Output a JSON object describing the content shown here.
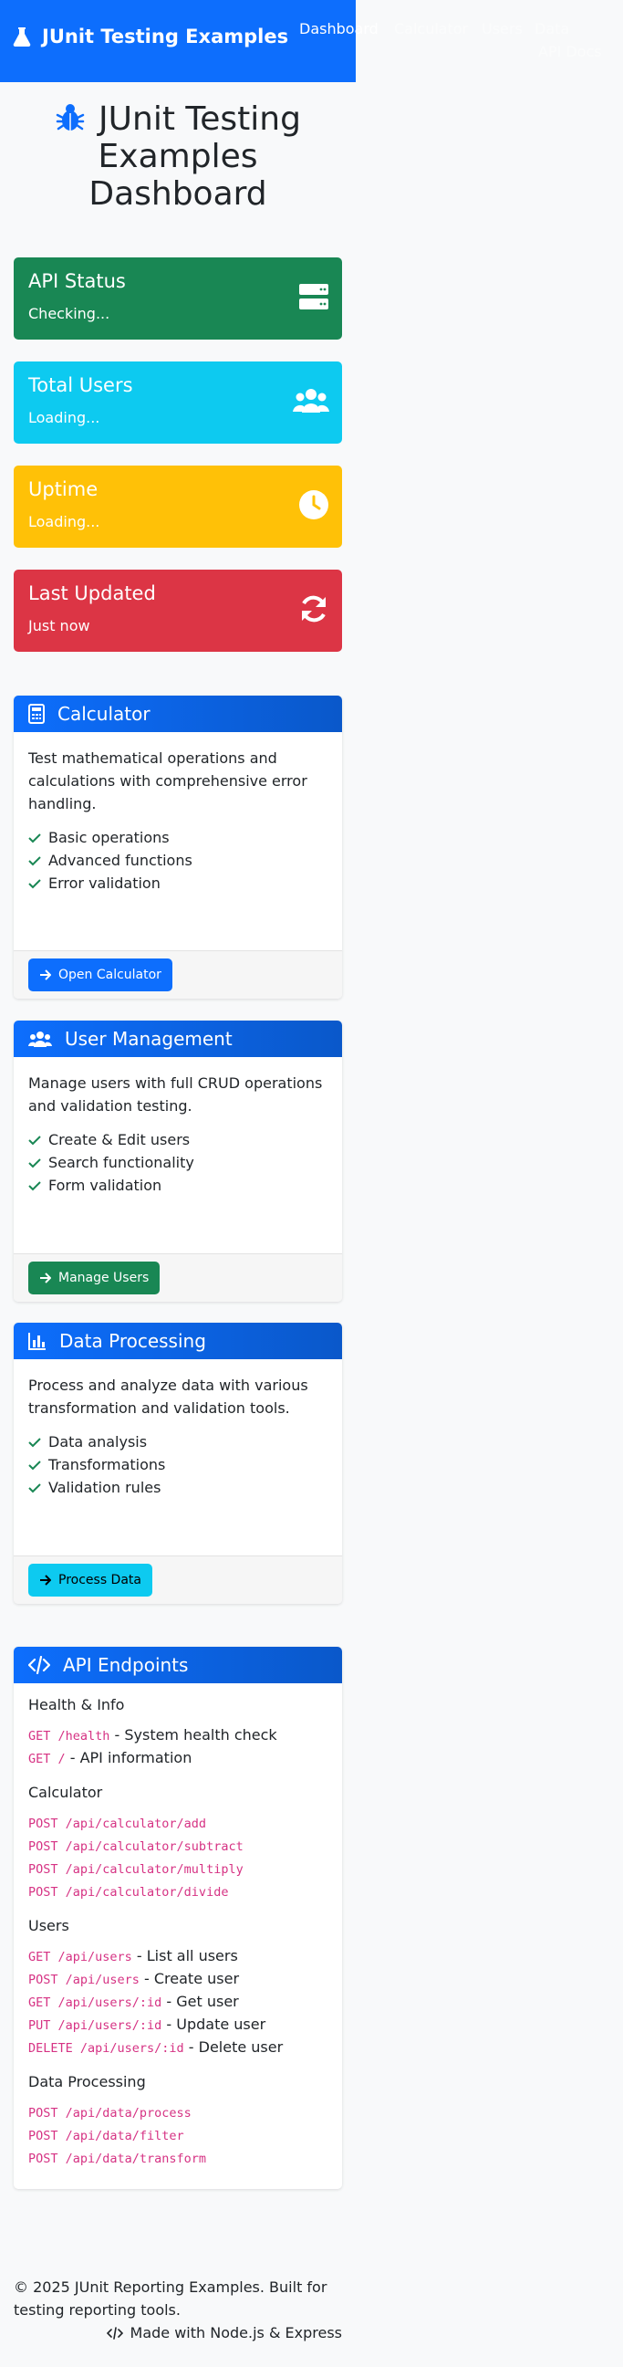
{
  "navbar": {
    "brand": "JUnit Testing Examples",
    "link_dashboard": "Dashboard",
    "link_calculator": "Calculator",
    "link_users": "Users",
    "link_data": "Data",
    "link_api": "API Docs"
  },
  "hero": {
    "title_line1": "JUnit Testing",
    "title_line2": "Examples",
    "title_line3": "Dashboard"
  },
  "stats": [
    {
      "title": "API Status",
      "value": "Checking...",
      "color": "#198754",
      "icon": "server-icon"
    },
    {
      "title": "Total Users",
      "value": "Loading...",
      "color": "#0dcaf0",
      "icon": "users-icon"
    },
    {
      "title": "Uptime",
      "value": "Loading...",
      "color": "#ffc107",
      "icon": "clock-icon"
    },
    {
      "title": "Last Updated",
      "value": "Just now",
      "color": "#dc3545",
      "icon": "sync-icon"
    }
  ],
  "cards": [
    {
      "title": "Calculator",
      "description": "Test mathematical operations and calculations with comprehensive error handling.",
      "features": [
        "Basic operations",
        "Advanced functions",
        "Error validation"
      ],
      "button": "Open Calculator",
      "button_color": "#0d6efd"
    },
    {
      "title": "User Management",
      "description": "Manage users with full CRUD operations and validation testing.",
      "features": [
        "Create & Edit users",
        "Search functionality",
        "Form validation"
      ],
      "button": "Manage Users",
      "button_color": "#198754"
    },
    {
      "title": "Data Processing",
      "description": "Process and analyze data with various transformation and validation tools.",
      "features": [
        "Data analysis",
        "Transformations",
        "Validation rules"
      ],
      "button": "Process Data",
      "button_color": "#0dcaf0"
    }
  ],
  "api": {
    "title": "API Endpoints",
    "sections": [
      {
        "heading": "Health & Info",
        "endpoints": [
          {
            "route": "GET /health",
            "desc": " - System health check"
          },
          {
            "route": "GET /",
            "desc": " - API information"
          }
        ]
      },
      {
        "heading": "Calculator",
        "endpoints": [
          {
            "route": "POST /api/calculator/add",
            "desc": ""
          },
          {
            "route": "POST /api/calculator/subtract",
            "desc": ""
          },
          {
            "route": "POST /api/calculator/multiply",
            "desc": ""
          },
          {
            "route": "POST /api/calculator/divide",
            "desc": ""
          }
        ]
      },
      {
        "heading": "Users",
        "endpoints": [
          {
            "route": "GET /api/users",
            "desc": " - List all users"
          },
          {
            "route": "POST /api/users",
            "desc": " - Create user"
          },
          {
            "route": "GET /api/users/:id",
            "desc": " - Get user"
          },
          {
            "route": "PUT /api/users/:id",
            "desc": " - Update user"
          },
          {
            "route": "DELETE /api/users/:id",
            "desc": " - Delete user"
          }
        ]
      },
      {
        "heading": "Data Processing",
        "endpoints": [
          {
            "route": "POST /api/data/process",
            "desc": ""
          },
          {
            "route": "POST /api/data/filter",
            "desc": ""
          },
          {
            "route": "POST /api/data/transform",
            "desc": ""
          }
        ]
      }
    ]
  },
  "footer": {
    "copyright": "© 2025 JUnit Reporting Examples. Built for testing reporting tools.",
    "made_with": "Made with Node.js & Express"
  }
}
